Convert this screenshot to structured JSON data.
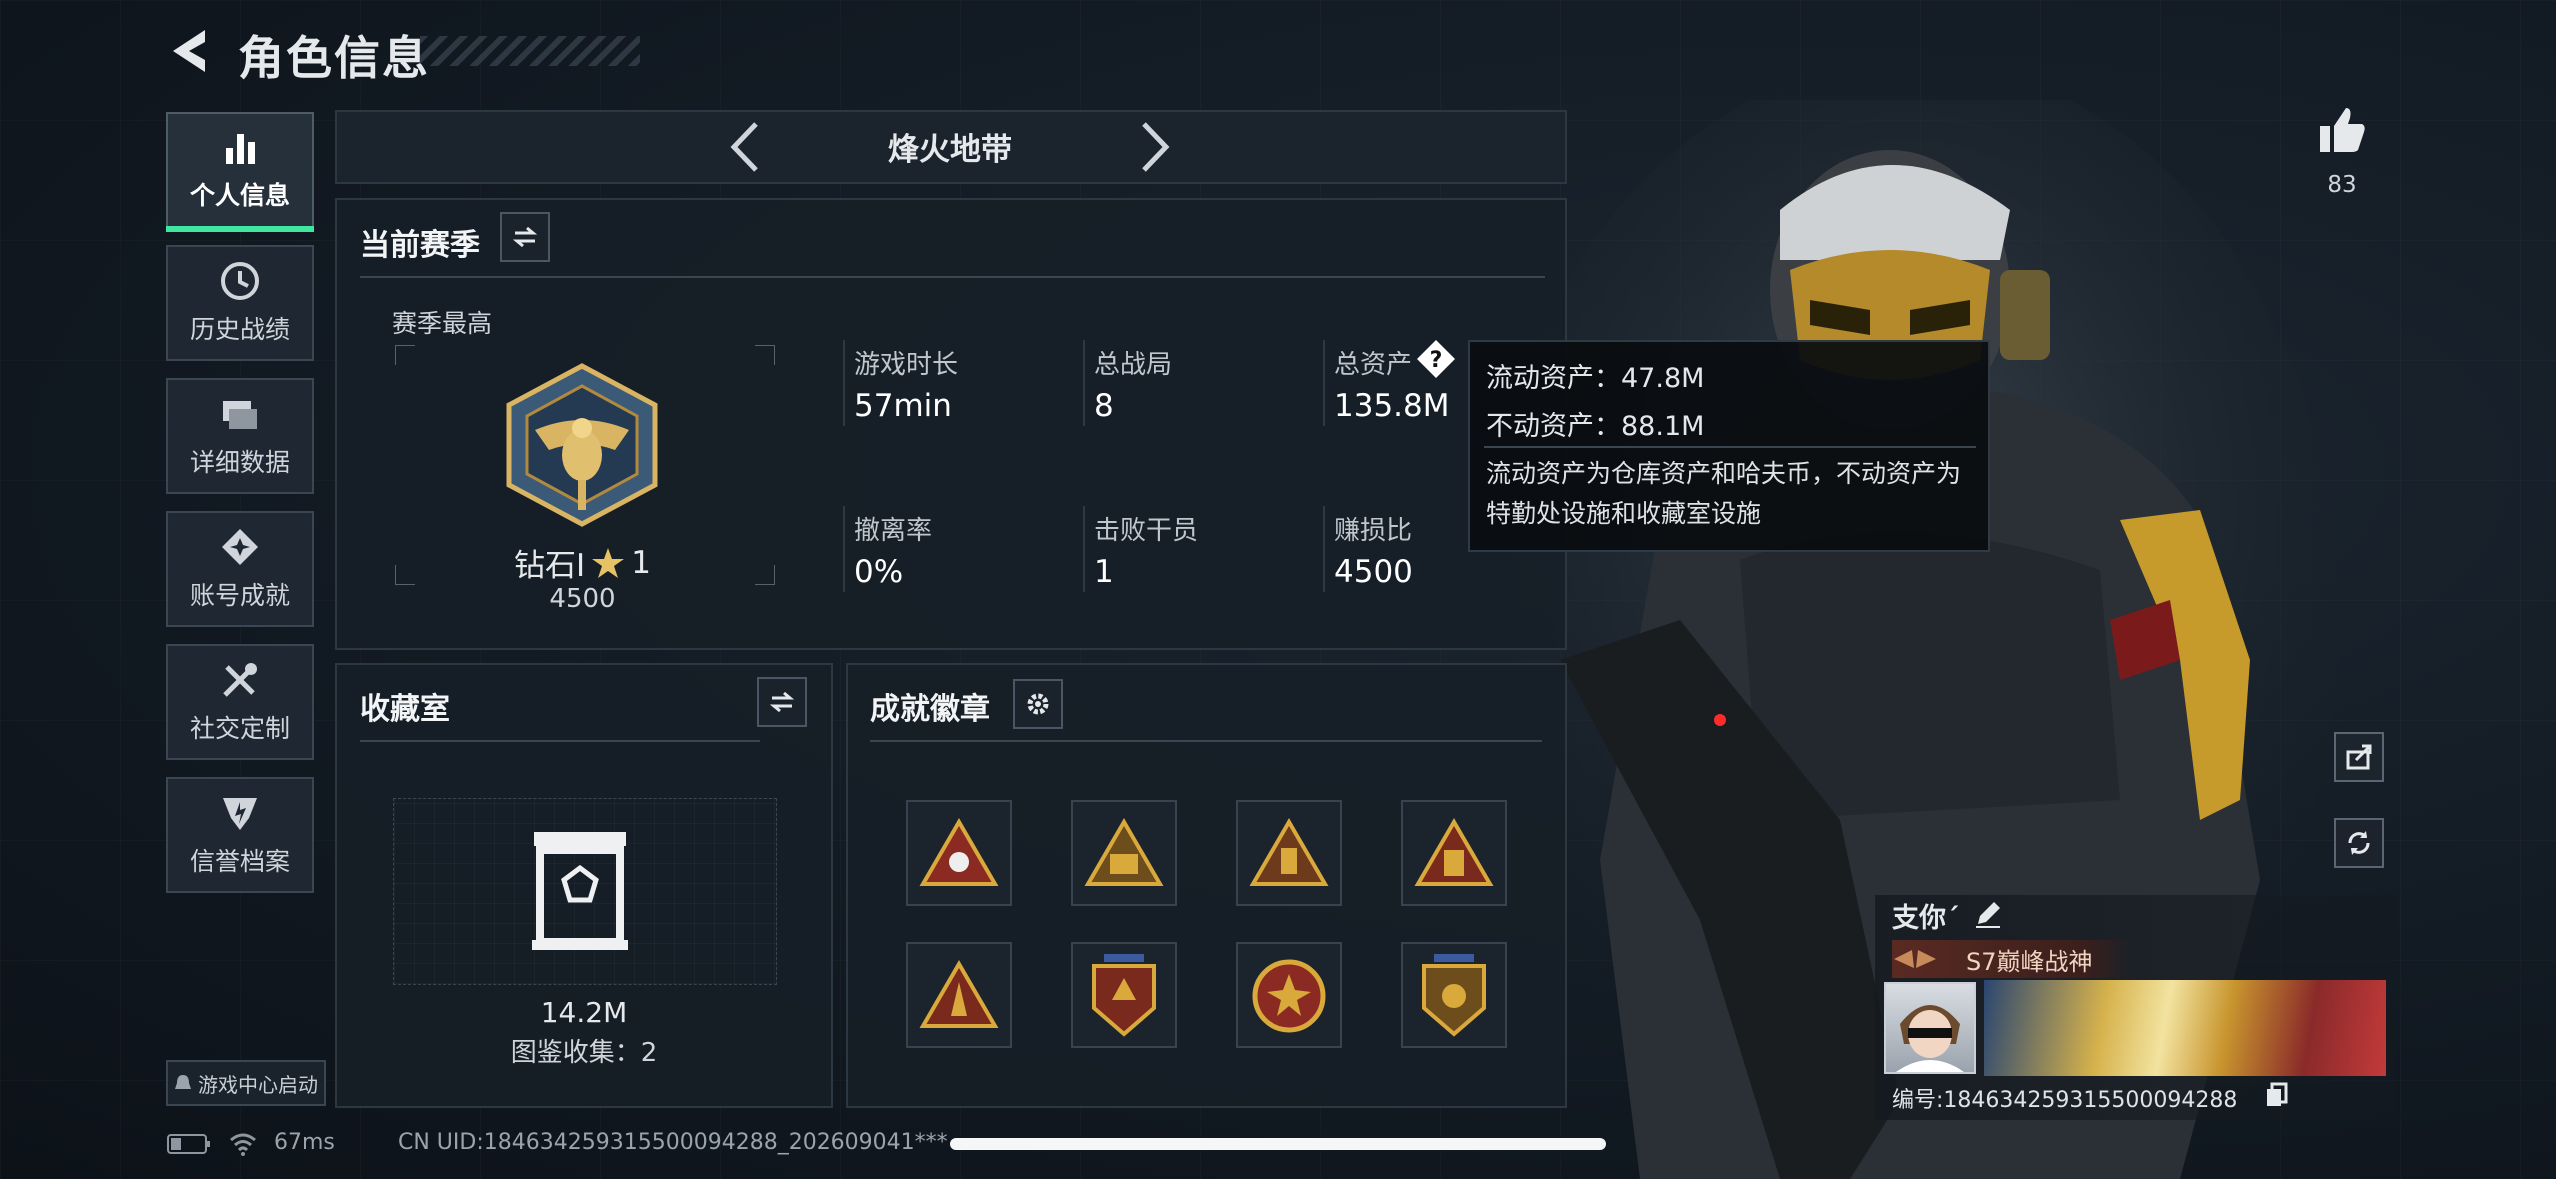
{
  "header": {
    "title": "角色信息"
  },
  "sidebar": {
    "items": [
      {
        "label": "个人信息",
        "icon": "bar-chart-icon",
        "active": true
      },
      {
        "label": "历史战绩",
        "icon": "clock-icon"
      },
      {
        "label": "详细数据",
        "icon": "folders-icon"
      },
      {
        "label": "账号成就",
        "icon": "achievement-icon"
      },
      {
        "label": "社交定制",
        "icon": "tools-icon"
      },
      {
        "label": "信誉档案",
        "icon": "shield-icon"
      }
    ],
    "game_center": "游戏中心启动"
  },
  "mode_selector": {
    "label": "烽火地带"
  },
  "season": {
    "title": "当前赛季",
    "best_label": "赛季最高",
    "rank_name": "钻石I",
    "rank_stars": "1",
    "rank_score": "4500",
    "stats": [
      {
        "label": "游戏时长",
        "value": "57min"
      },
      {
        "label": "总战局",
        "value": "8"
      },
      {
        "label": "总资产",
        "value": "135.8M"
      },
      {
        "label": "撤离率",
        "value": "0%"
      },
      {
        "label": "击败干员",
        "value": "1"
      },
      {
        "label": "赚损比",
        "value": "4500"
      }
    ]
  },
  "tooltip": {
    "liquid": "流动资产：47.8M",
    "fixed": "不动资产：88.1M",
    "desc": "流动资产为仓库资产和哈夫币，不动资产为特勤处设施和收藏室设施"
  },
  "collection": {
    "title": "收藏室",
    "value": "14.2M",
    "count_label": "图鉴收集：2"
  },
  "badges": {
    "title": "成就徽章"
  },
  "profile": {
    "likes": "83",
    "name": "支你´",
    "title_tag": "S7巅峰战神",
    "id_line": "编号:1846342593155000942​88"
  },
  "status_bar": {
    "ping": "67ms",
    "uid": "CN UID:18463425931550009428​8_202609041​***"
  },
  "colors": {
    "accent": "#40e6a0",
    "gold": "#d9a93c",
    "panel": "#161e27"
  }
}
